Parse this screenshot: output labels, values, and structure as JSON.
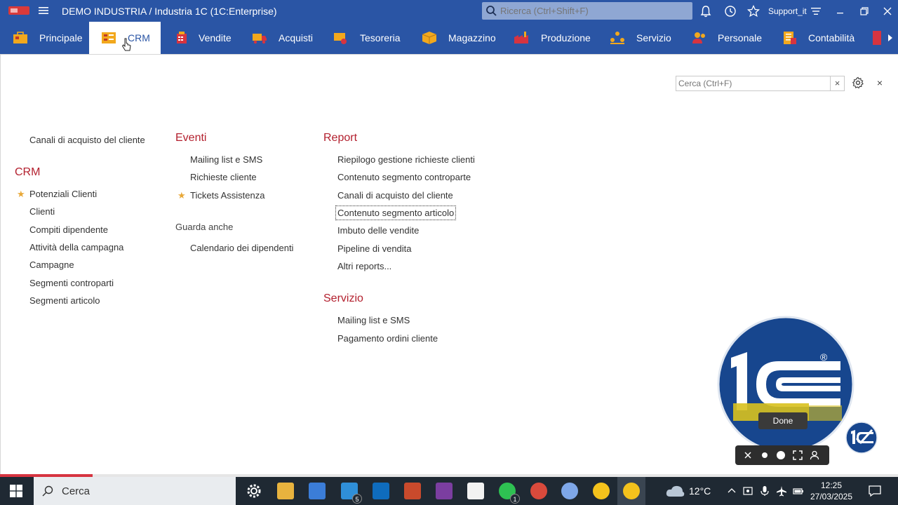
{
  "window": {
    "title": "DEMO INDUSTRIA / Industria 1C  (1C:Enterprise)",
    "search_placeholder": "Ricerca (Ctrl+Shift+F)",
    "user": "Support_it"
  },
  "sections": [
    {
      "label": "Principale",
      "icon": "briefcase-icon"
    },
    {
      "label": "CRM",
      "icon": "crm-icon"
    },
    {
      "label": "Vendite",
      "icon": "cash-register-icon"
    },
    {
      "label": "Acquisti",
      "icon": "truck-icon"
    },
    {
      "label": "Tesoreria",
      "icon": "treasury-icon"
    },
    {
      "label": "Magazzino",
      "icon": "box-icon"
    },
    {
      "label": "Produzione",
      "icon": "factory-icon"
    },
    {
      "label": "Servizio",
      "icon": "service-icon"
    },
    {
      "label": "Personale",
      "icon": "people-icon"
    },
    {
      "label": "Contabilità",
      "icon": "accounting-icon"
    }
  ],
  "panel": {
    "search_placeholder": "Cerca (Ctrl+F)",
    "clear": "×",
    "close": "×",
    "col1": {
      "top_item": "Canali di acquisto del cliente",
      "crm_header": "CRM",
      "crm_items": [
        "Potenziali Clienti",
        "Clienti",
        "Compiti dipendente",
        "Attività della campagna",
        "Campagne",
        "Segmenti controparti",
        "Segmenti articolo"
      ]
    },
    "col2": {
      "eventi_header": "Eventi",
      "eventi_items": [
        "Mailing list e SMS",
        "Richieste cliente",
        "Tickets Assistenza"
      ],
      "guarda_header": "Guarda anche",
      "guarda_items": [
        "Calendario dei dipendenti"
      ]
    },
    "col3": {
      "report_header": "Report",
      "report_items": [
        "Riepilogo gestione richieste clienti",
        "Contenuto segmento controparte",
        "Canali di acquisto del cliente",
        "Contenuto segmento articolo",
        "Imbuto delle vendite",
        "Pipeline di vendita",
        "Altri reports..."
      ],
      "servizio_header": "Servizio",
      "servizio_items": [
        "Mailing list e SMS",
        "Pagamento ordini cliente"
      ]
    }
  },
  "overlay": {
    "done_tooltip": "Done",
    "logo_registered": "®"
  },
  "taskbar": {
    "search_label": "Cerca",
    "outlook_badge": "5",
    "whatsapp_badge": "1",
    "temperature": "12°C",
    "time": "12:25",
    "date": "27/03/2025"
  },
  "colors": {
    "brand_blue": "#2a55a5",
    "header_red": "#b3202e",
    "star": "#e8a838"
  }
}
